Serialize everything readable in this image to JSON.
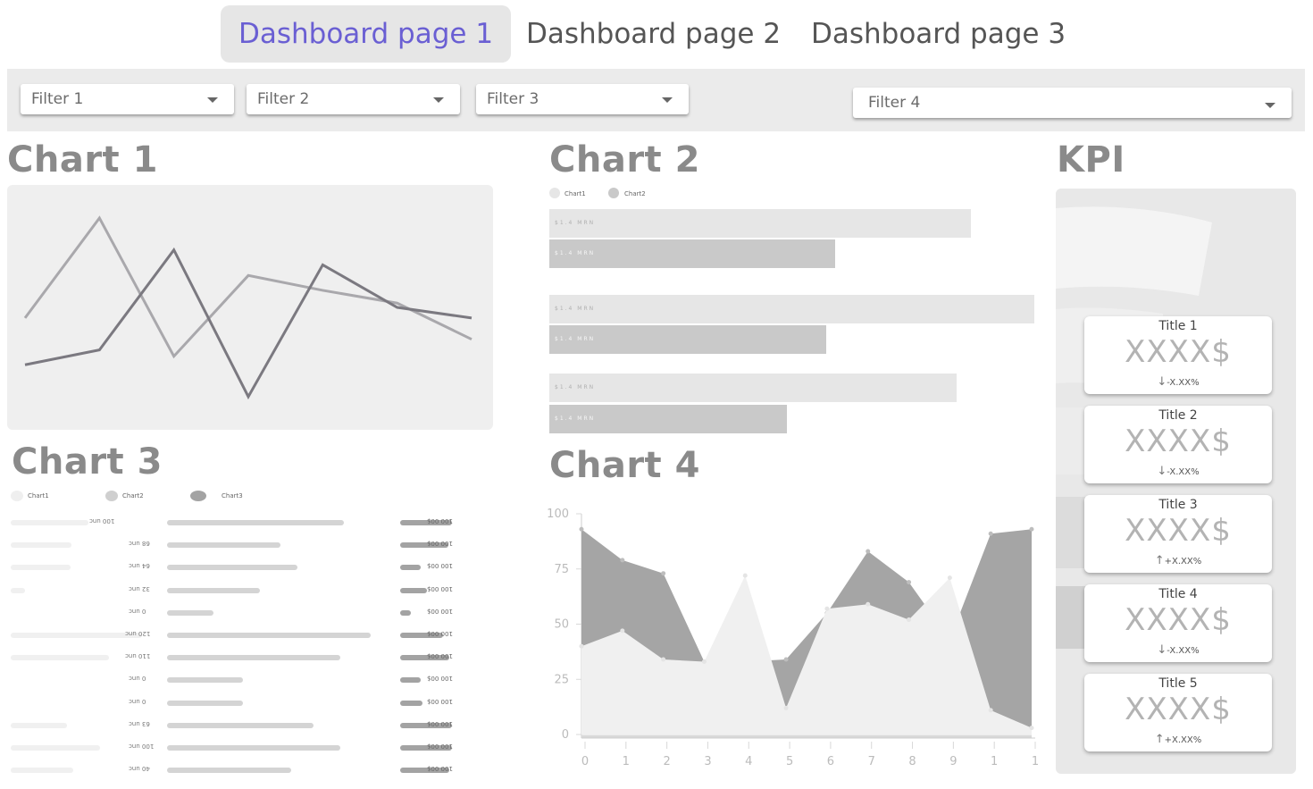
{
  "tabs": [
    {
      "label": "Dashboard page 1",
      "active": true
    },
    {
      "label": "Dashboard page 2",
      "active": false
    },
    {
      "label": "Dashboard page 3",
      "active": false
    }
  ],
  "filters": [
    {
      "label": "Filter 1"
    },
    {
      "label": "Filter 2"
    },
    {
      "label": "Filter 3"
    },
    {
      "label": "Filter 4"
    }
  ],
  "colors": {
    "accent": "#6a5fd3",
    "panel": "#efefef",
    "line_light": "#a9a8ac",
    "line_dark": "#7b7980",
    "bar_light": "#e6e6e6",
    "bar_dark": "#c9c9c9",
    "area_dark": "#a5a5a5",
    "area_light": "#f0f0f0"
  },
  "chart1": {
    "title": "Chart 1"
  },
  "chart2": {
    "title": "Chart 2",
    "legend": [
      "Chart1",
      "Chart2"
    ],
    "bar_label": "$1.4 MRN"
  },
  "chart3": {
    "title": "Chart 3",
    "legend": [
      "Chart1",
      "Chart2",
      "Chart3"
    ]
  },
  "chart4": {
    "title": "Chart 4"
  },
  "kpi": {
    "title": "KPI",
    "cards": [
      {
        "title": "Title 1",
        "value": "XXXX$",
        "delta": "-X.XX%",
        "direction": "down"
      },
      {
        "title": "Title 2",
        "value": "XXXX$",
        "delta": "-X.XX%",
        "direction": "down"
      },
      {
        "title": "Title 3",
        "value": "XXXX$",
        "delta": "+X.XX%",
        "direction": "up"
      },
      {
        "title": "Title 4",
        "value": "XXXX$",
        "delta": "-X.XX%",
        "direction": "down"
      },
      {
        "title": "Title 5",
        "value": "XXXX$",
        "delta": "+X.XX%",
        "direction": "up"
      }
    ]
  },
  "chart_data": [
    {
      "type": "line",
      "x": [
        0,
        1,
        2,
        3,
        4,
        5,
        6
      ],
      "series": [
        {
          "name": "",
          "values": [
            0.45,
            0.92,
            0.27,
            0.65,
            0.58,
            0.52,
            0.35
          ],
          "color": "#a9a8ac"
        },
        {
          "name": "",
          "values": [
            0.23,
            0.3,
            0.77,
            0.08,
            0.7,
            0.5,
            0.45
          ],
          "color": "#7b7980"
        }
      ],
      "ylim": [
        0,
        1
      ]
    },
    {
      "type": "bar",
      "orientation": "horizontal",
      "categories": [
        "",
        "",
        ""
      ],
      "series": [
        {
          "name": "Chart1",
          "values": [
            87,
            100,
            84
          ]
        },
        {
          "name": "Chart2",
          "values": [
            59,
            57,
            49
          ]
        }
      ],
      "xlim": [
        0,
        100
      ],
      "data_labels": "$1.4 MRN"
    },
    {
      "type": "bar",
      "orientation": "horizontal",
      "series": [
        {
          "name": "Chart1",
          "values": [
            87,
            68,
            67,
            16,
            0,
            147,
            110,
            0,
            0,
            63,
            100,
            70
          ],
          "labels": [
            "100 unc",
            "68 unc",
            "64 unc",
            "32 unc",
            "0 unc",
            "120 unc",
            "110 unc",
            "0 unc",
            "0 unc",
            "63 unc",
            "100 unc",
            "40 unc"
          ]
        },
        {
          "name": "Chart2",
          "values": [
            198,
            127,
            146,
            104,
            52,
            228,
            194,
            85,
            85,
            164,
            194,
            139
          ]
        },
        {
          "name": "Chart3",
          "values": [
            58,
            54,
            23,
            30,
            12,
            48,
            55,
            23,
            25,
            58,
            58,
            55
          ],
          "labels": [
            "100 00$",
            "100 00$",
            "100 00$",
            "100 00$",
            "100 00$",
            "100 00$",
            "100 00$",
            "100 00$",
            "100 00$",
            "100 00$",
            "100 00$",
            "100 00$"
          ]
        }
      ]
    },
    {
      "type": "area",
      "x": [
        0,
        1,
        2,
        3,
        4,
        5,
        6,
        7,
        8,
        9,
        10,
        11
      ],
      "x_tick_labels": [
        "0",
        "1",
        "2",
        "3",
        "4",
        "5",
        "6",
        "7",
        "8",
        "9",
        "1",
        "1"
      ],
      "y_ticks": [
        0,
        25,
        50,
        75,
        100
      ],
      "ylim": [
        0,
        100
      ],
      "series": [
        {
          "name": "",
          "values": [
            93,
            79,
            73,
            33,
            33,
            34,
            55,
            83,
            69,
            43,
            91,
            93
          ],
          "color": "#a5a5a5"
        },
        {
          "name": "",
          "values": [
            40,
            47,
            34,
            33,
            72,
            12,
            57,
            59,
            52,
            71,
            11,
            3
          ],
          "color": "#f0f0f0"
        }
      ]
    }
  ]
}
